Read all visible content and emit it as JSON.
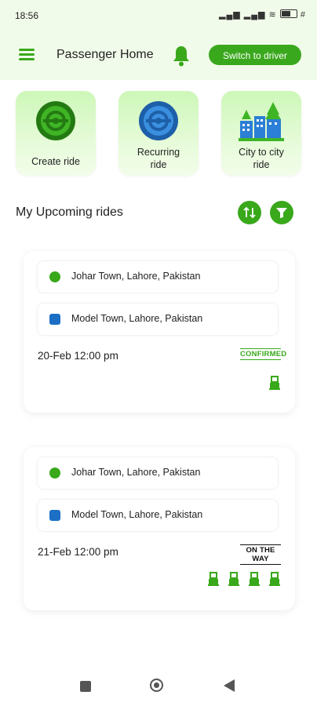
{
  "status_bar": {
    "time": "18:56",
    "icons": "▂▄▆ ▂▄▆ ≋",
    "extra": "#"
  },
  "header": {
    "title": "Passenger Home",
    "switch_label": "Switch to driver"
  },
  "actions": [
    {
      "label_line1": "Create ride",
      "label_line2": ""
    },
    {
      "label_line1": "Recurring",
      "label_line2": "ride"
    },
    {
      "label_line1": "City to city",
      "label_line2": "ride"
    }
  ],
  "section": {
    "title": "My Upcoming rides"
  },
  "rides": [
    {
      "pickup": "Johar Town, Lahore, Pakistan",
      "dropoff": "Model Town, Lahore, Pakistan",
      "date": "20-Feb 12:00 pm",
      "status": "CONFIRMED",
      "seats": 1
    },
    {
      "pickup": "Johar Town, Lahore, Pakistan",
      "dropoff": "Model Town, Lahore, Pakistan",
      "date": "21-Feb 12:00 pm",
      "status": "ON THE WAY",
      "seats": 4
    }
  ],
  "colors": {
    "accent": "#39a81b",
    "header_bg": "#f1fbe9",
    "blue": "#1b6fc5"
  }
}
